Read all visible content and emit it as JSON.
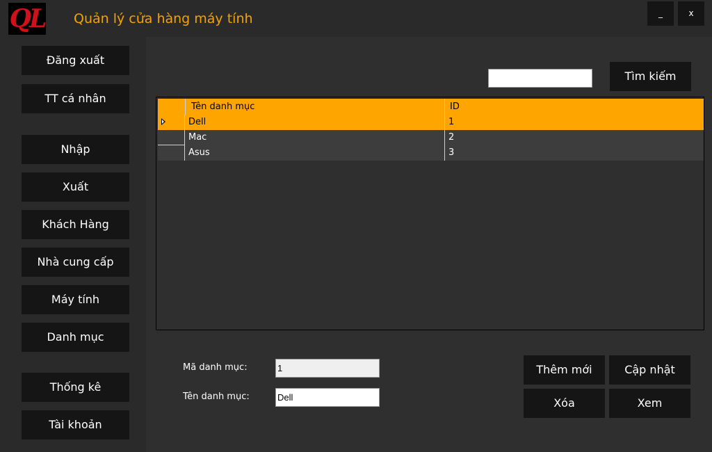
{
  "window": {
    "logo_text": "QL",
    "title": "Quản lý cửa hàng máy tính",
    "minimize_label": "_",
    "close_label": "x"
  },
  "sidebar": {
    "items": [
      {
        "label": "Đăng xuất"
      },
      {
        "label": "TT cá nhân"
      },
      {
        "label": "Nhập"
      },
      {
        "label": "Xuất"
      },
      {
        "label": "Khách Hàng"
      },
      {
        "label": "Nhà cung cấp"
      },
      {
        "label": "Máy tính"
      },
      {
        "label": "Danh mục"
      },
      {
        "label": "Thống kê"
      },
      {
        "label": "Tài khoản"
      }
    ]
  },
  "search": {
    "value": "",
    "button_label": "Tìm kiếm"
  },
  "grid": {
    "columns": [
      "Tên danh mục",
      "ID"
    ],
    "rows": [
      {
        "name": "Dell",
        "id": "1",
        "selected": true
      },
      {
        "name": "Mac",
        "id": "2",
        "selected": false
      },
      {
        "name": "Asus",
        "id": "3",
        "selected": false
      }
    ]
  },
  "form": {
    "id_label": "Mã danh mục:",
    "id_value": "1",
    "name_label": "Tên danh mục:",
    "name_value": "Dell"
  },
  "actions": {
    "add_label": "Thêm mới",
    "update_label": "Cập nhật",
    "delete_label": "Xóa",
    "view_label": "Xem"
  },
  "colors": {
    "accent": "#ffa500",
    "title": "#f5a200",
    "button_bg": "#151515",
    "panel_bg": "#2f2f2f",
    "sidebar_bg": "#2a2a2a"
  }
}
